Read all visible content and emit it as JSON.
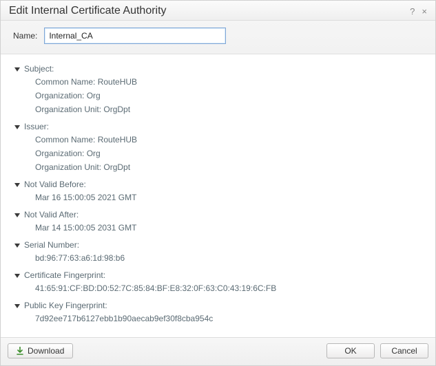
{
  "dialog": {
    "title": "Edit Internal Certificate Authority",
    "help_tip": "?",
    "close_tip": "×"
  },
  "name": {
    "label": "Name:",
    "value": "Internal_CA"
  },
  "sections": {
    "subject": {
      "title": "Subject:",
      "common_name_label": "Common Name:",
      "common_name_value": "RouteHUB",
      "organization_label": "Organization:",
      "organization_value": "Org",
      "org_unit_label": "Organization Unit:",
      "org_unit_value": "OrgDpt"
    },
    "issuer": {
      "title": "Issuer:",
      "common_name_label": "Common Name:",
      "common_name_value": "RouteHUB",
      "organization_label": "Organization:",
      "organization_value": "Org",
      "org_unit_label": "Organization Unit:",
      "org_unit_value": "OrgDpt"
    },
    "not_before": {
      "title": "Not Valid Before:",
      "value": "Mar 16 15:00:05 2021 GMT"
    },
    "not_after": {
      "title": "Not Valid After:",
      "value": "Mar 14 15:00:05 2031 GMT"
    },
    "serial": {
      "title": "Serial Number:",
      "value": "bd:96:77:63:a6:1d:98:b6"
    },
    "cert_fp": {
      "title": "Certificate Fingerprint:",
      "value": "41:65:91:CF:BD:D0:52:7C:85:84:BF:E8:32:0F:63:C0:43:19:6C:FB"
    },
    "pub_fp": {
      "title": "Public Key Fingerprint:",
      "value": "7d92ee717b6127ebb1b90aecab9ef30f8cba954c"
    }
  },
  "buttons": {
    "download": "Download",
    "ok": "OK",
    "cancel": "Cancel"
  }
}
